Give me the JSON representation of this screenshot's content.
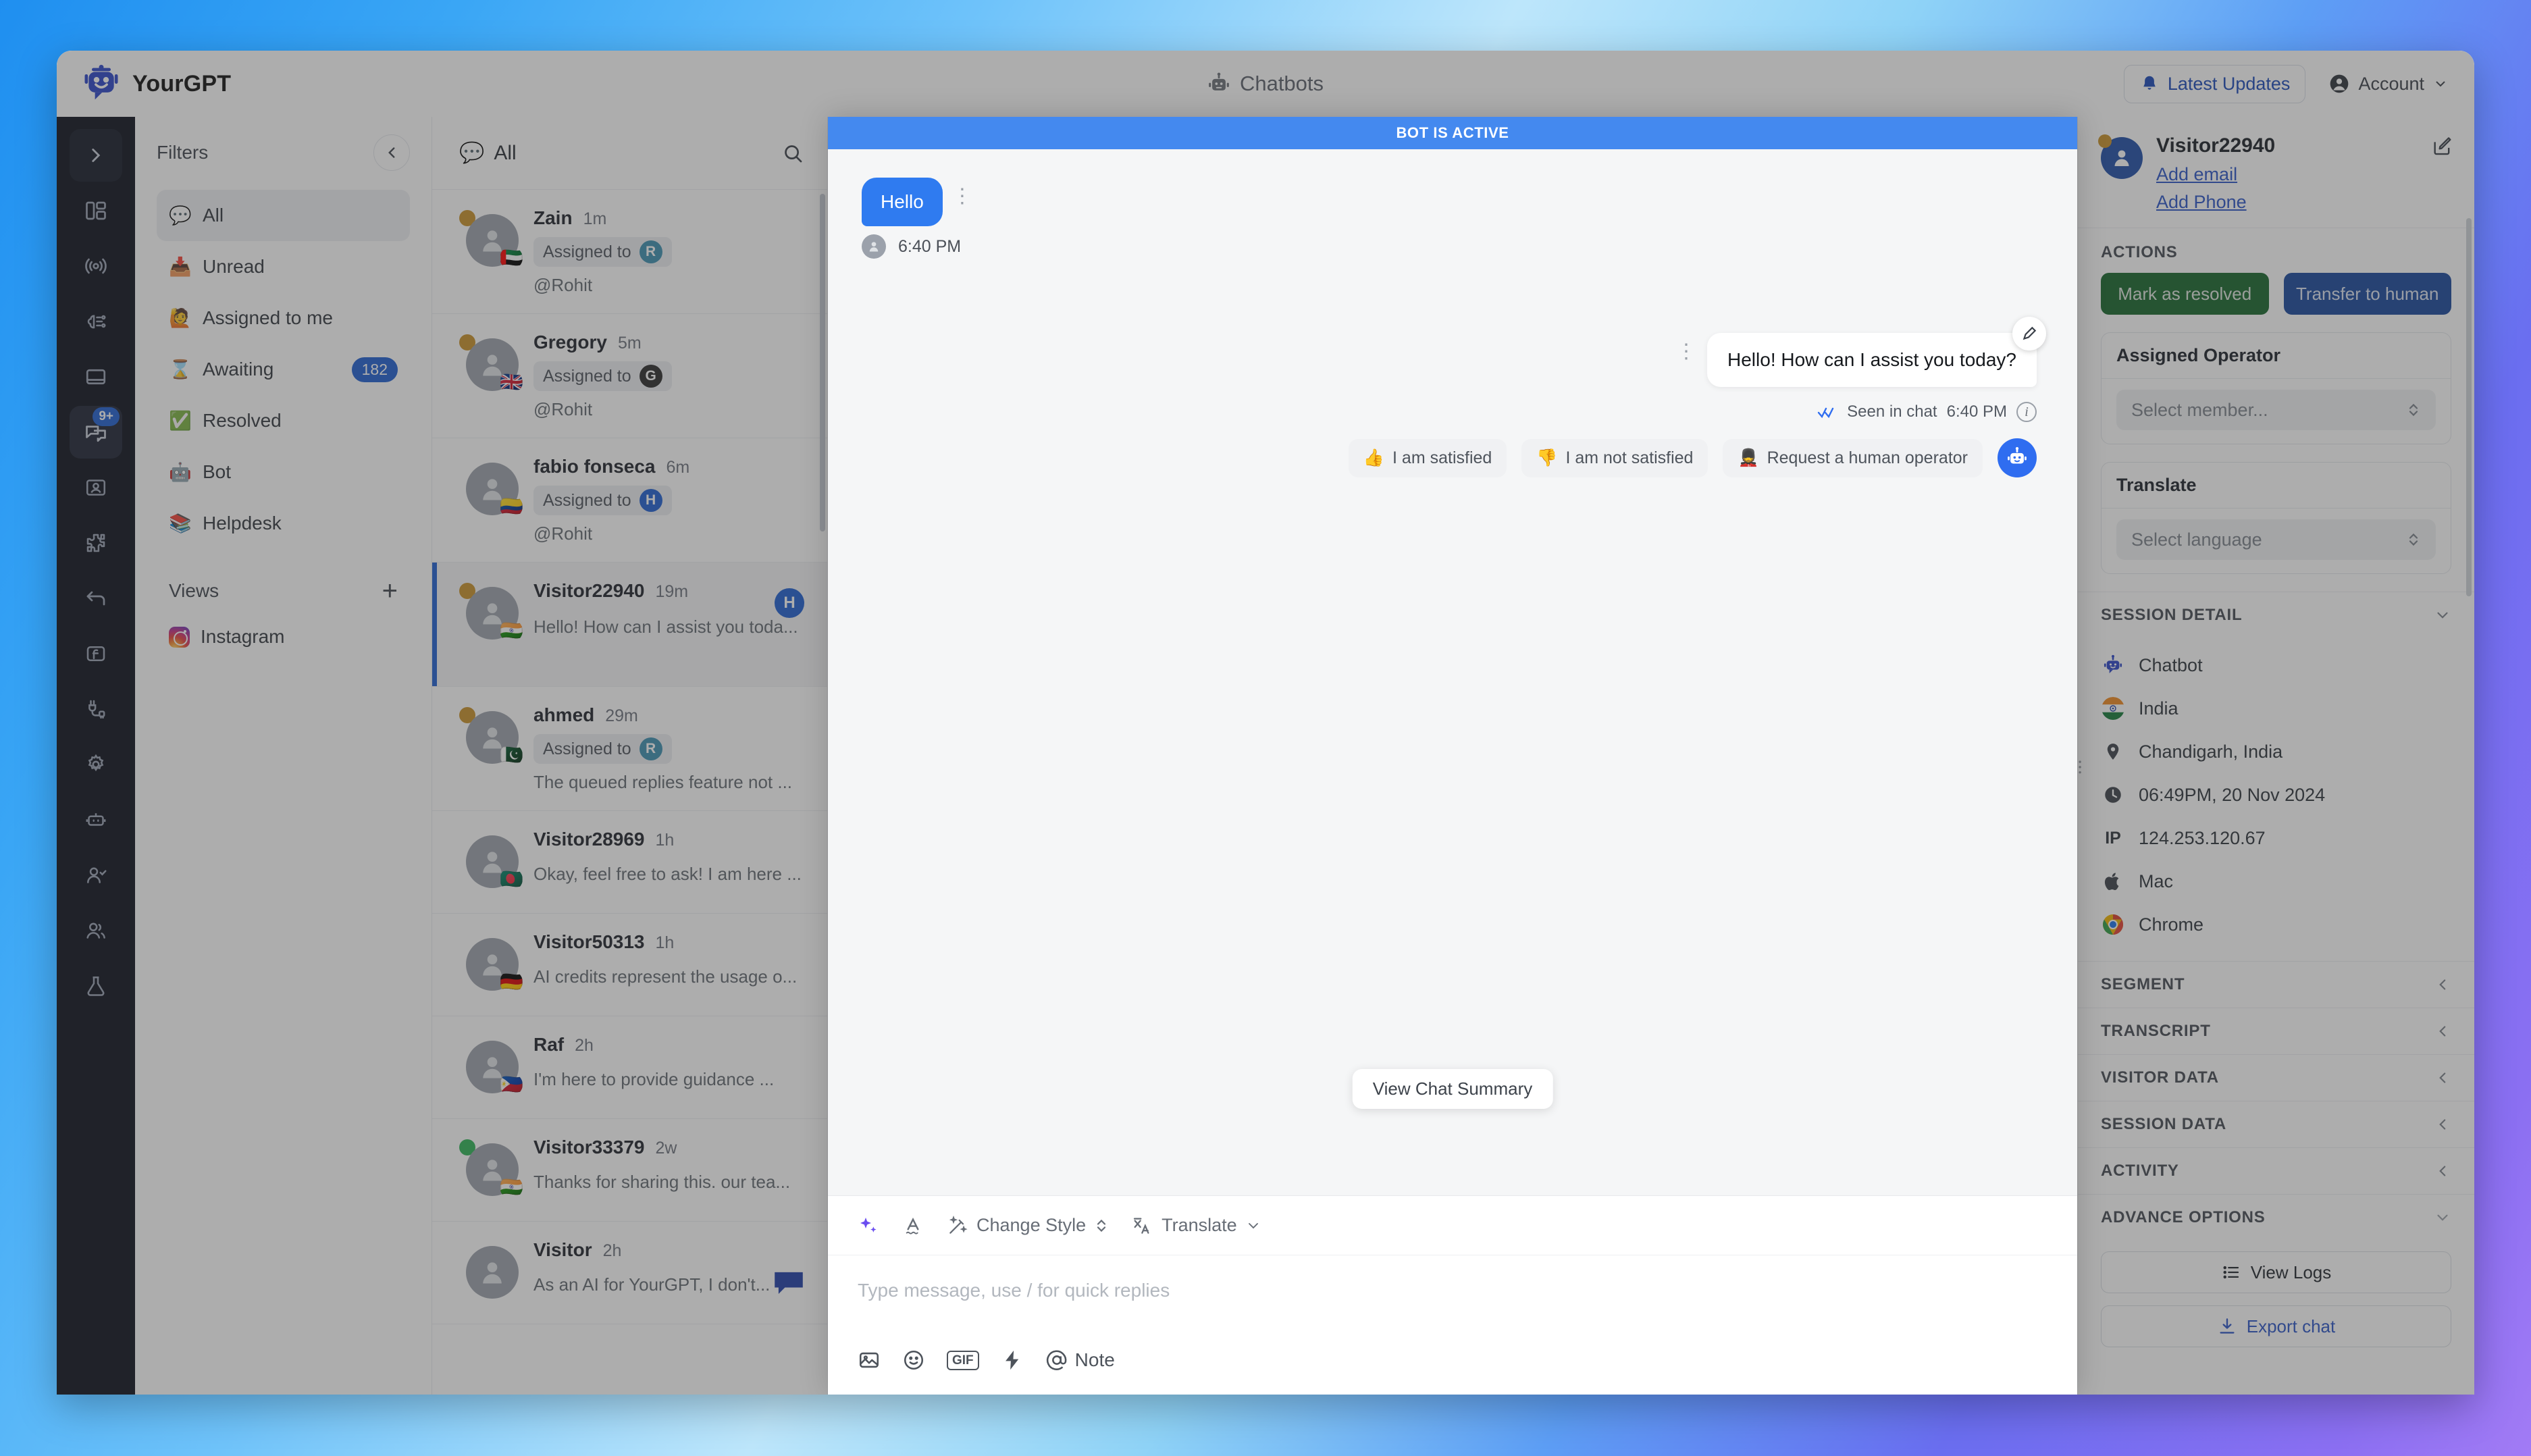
{
  "topbar": {
    "brand": "YourGPT",
    "center_title": "Chatbots",
    "updates_label": "Latest Updates",
    "account_label": "Account"
  },
  "rail": {
    "items": [
      {
        "name": "expand-chevron",
        "glyph": "chevron-right"
      },
      {
        "name": "dashboard",
        "glyph": "layout"
      },
      {
        "name": "broadcast",
        "glyph": "signal"
      },
      {
        "name": "ai-brain",
        "glyph": "brain"
      },
      {
        "name": "widget",
        "glyph": "window"
      },
      {
        "name": "inbox",
        "glyph": "chats",
        "badge": "9+"
      },
      {
        "name": "contacts",
        "glyph": "id-card"
      },
      {
        "name": "integrations",
        "glyph": "puzzle"
      },
      {
        "name": "automations",
        "glyph": "arrow-back"
      },
      {
        "name": "functions",
        "glyph": "function"
      },
      {
        "name": "connections",
        "glyph": "plug"
      },
      {
        "name": "settings",
        "glyph": "gear"
      },
      {
        "name": "bot",
        "glyph": "robot"
      },
      {
        "name": "agent-check",
        "glyph": "user-check"
      },
      {
        "name": "team",
        "glyph": "users"
      },
      {
        "name": "labs",
        "glyph": "flask"
      }
    ]
  },
  "filters": {
    "title": "Filters",
    "items": [
      {
        "emoji": "💬",
        "label": "All",
        "badge": "",
        "selected": true
      },
      {
        "emoji": "📥",
        "label": "Unread",
        "badge": "",
        "selected": false
      },
      {
        "emoji": "🙋",
        "label": "Assigned to me",
        "badge": "",
        "selected": false
      },
      {
        "emoji": "⌛",
        "label": "Awaiting",
        "badge": "182",
        "selected": false
      },
      {
        "emoji": "✅",
        "label": "Resolved",
        "badge": "",
        "selected": false
      },
      {
        "emoji": "🤖",
        "label": "Bot",
        "badge": "",
        "selected": false
      },
      {
        "emoji": "📚",
        "label": "Helpdesk",
        "badge": "",
        "selected": false
      }
    ],
    "views_title": "Views",
    "views": [
      {
        "icon": "instagram-icon",
        "label": "Instagram"
      }
    ]
  },
  "conversations": {
    "header_label": "All",
    "header_emoji": "💬",
    "rows": [
      {
        "name": "Zain",
        "time": "1m",
        "assigned_label": "Assigned to",
        "assignee_initial": "R",
        "assignee_color": "#3d8fb0",
        "sub": "@Rohit",
        "flag": "🇦🇪",
        "status": "#c8912a",
        "active": false,
        "badge": "",
        "chat_icon": false
      },
      {
        "name": "Gregory",
        "time": "5m",
        "assigned_label": "Assigned to",
        "assignee_initial": "G",
        "assignee_color": "#2b2b2b",
        "sub": "@Rohit",
        "flag": "🇬🇧",
        "status": "#c8912a",
        "active": false,
        "badge": "",
        "chat_icon": false
      },
      {
        "name": "fabio fonseca",
        "time": "6m",
        "assigned_label": "Assigned to",
        "assignee_initial": "H",
        "assignee_color": "#1f5fd0",
        "sub": "@Rohit",
        "flag": "🇨🇴",
        "status": "",
        "active": false,
        "badge": "",
        "chat_icon": false
      },
      {
        "name": "Visitor22940",
        "time": "19m",
        "assigned_label": "",
        "assignee_initial": "",
        "assignee_color": "",
        "sub": "Hello! How can I assist you toda...",
        "flag": "🇮🇳",
        "status": "#c8912a",
        "active": true,
        "badge": "H",
        "chat_icon": false
      },
      {
        "name": "ahmed",
        "time": "29m",
        "assigned_label": "Assigned to",
        "assignee_initial": "R",
        "assignee_color": "#3d8fb0",
        "sub": "The queued replies feature not ...",
        "flag": "🇵🇰",
        "status": "#c8912a",
        "active": false,
        "badge": "",
        "chat_icon": false
      },
      {
        "name": "Visitor28969",
        "time": "1h",
        "assigned_label": "",
        "assignee_initial": "",
        "assignee_color": "",
        "sub": "Okay, feel free to ask! I am here ...",
        "flag": "🇧🇩",
        "status": "",
        "active": false,
        "badge": "",
        "chat_icon": false
      },
      {
        "name": "Visitor50313",
        "time": "1h",
        "assigned_label": "",
        "assignee_initial": "",
        "assignee_color": "",
        "sub": "AI credits represent the usage o...",
        "flag": "🇩🇪",
        "status": "",
        "active": false,
        "badge": "",
        "chat_icon": false
      },
      {
        "name": "Raf",
        "time": "2h",
        "assigned_label": "",
        "assignee_initial": "",
        "assignee_color": "",
        "sub": "I'm here to provide guidance ...",
        "flag": "🇵🇭",
        "status": "",
        "active": false,
        "badge": "",
        "chat_icon": false
      },
      {
        "name": "Visitor33379",
        "time": "2w",
        "assigned_label": "",
        "assignee_initial": "",
        "assignee_color": "",
        "sub": "Thanks for sharing this. our tea...",
        "flag": "🇮🇳",
        "status": "#2fb457",
        "active": false,
        "badge": "",
        "chat_icon": false
      },
      {
        "name": "Visitor",
        "time": "2h",
        "assigned_label": "",
        "assignee_initial": "",
        "assignee_color": "",
        "sub": "As an AI for YourGPT, I don't...",
        "flag": "",
        "status": "",
        "active": false,
        "badge": "",
        "chat_icon": true
      }
    ]
  },
  "chat": {
    "status_bar": "BOT IS ACTIVE",
    "incoming": {
      "text": "Hello",
      "time": "6:40 PM"
    },
    "outgoing": {
      "text": "Hello! How can I assist you today?",
      "seen_label": "Seen in chat",
      "time": "6:40 PM"
    },
    "quick_replies": [
      {
        "emoji": "👍",
        "label": "I am satisfied"
      },
      {
        "emoji": "👎",
        "label": "I am not satisfied"
      },
      {
        "emoji": "💂",
        "label": "Request a human operator"
      }
    ],
    "summary_tooltip": "View Chat Summary"
  },
  "composer": {
    "tools": [
      {
        "icon": "sparkles-icon",
        "label": ""
      },
      {
        "icon": "font-style-icon",
        "label": ""
      },
      {
        "icon": "magic-wand-icon",
        "label": "Change Style"
      },
      {
        "icon": "translate-icon",
        "label": "Translate"
      }
    ],
    "placeholder": "Type message, use / for quick replies",
    "bottom_icons": [
      {
        "icon": "image-icon",
        "label": ""
      },
      {
        "icon": "emoji-icon",
        "label": ""
      },
      {
        "icon": "gif-icon",
        "label": "GIF"
      },
      {
        "icon": "lightning-icon",
        "label": ""
      },
      {
        "icon": "at-icon",
        "label": "Note"
      }
    ]
  },
  "rightbar": {
    "visitor_name": "Visitor22940",
    "add_email": "Add email",
    "add_phone": "Add Phone",
    "actions_title": "ACTIONS",
    "mark_resolved": "Mark as resolved",
    "transfer_human": "Transfer to human",
    "assigned_operator_title": "Assigned Operator",
    "assigned_operator_placeholder": "Select member...",
    "translate_title": "Translate",
    "translate_placeholder": "Select language",
    "session_detail_title": "SESSION DETAIL",
    "session_details": [
      {
        "icon": "chatbot-icon",
        "value": "Chatbot"
      },
      {
        "icon": "flag-india-icon",
        "value": "India"
      },
      {
        "icon": "location-pin-icon",
        "value": "Chandigarh, India"
      },
      {
        "icon": "clock-icon",
        "value": "06:49PM, 20 Nov 2024"
      },
      {
        "icon": "ip-icon",
        "value": "124.253.120.67"
      },
      {
        "icon": "apple-icon",
        "value": "Mac"
      },
      {
        "icon": "chrome-icon",
        "value": "Chrome"
      }
    ],
    "accordions": [
      {
        "title": "SEGMENT",
        "state": "collapsed"
      },
      {
        "title": "TRANSCRIPT",
        "state": "collapsed"
      },
      {
        "title": "VISITOR DATA",
        "state": "collapsed"
      },
      {
        "title": "SESSION DATA",
        "state": "collapsed"
      },
      {
        "title": "ACTIVITY",
        "state": "collapsed"
      },
      {
        "title": "ADVANCE OPTIONS",
        "state": "expanded"
      }
    ],
    "view_logs": "View Logs",
    "export_chat": "Export chat"
  },
  "colors": {
    "accent_blue": "#1f5fd0",
    "bot_bar_blue": "#4489ef",
    "bubble_in_blue": "#2f7bf0",
    "resolve_green": "#17662c",
    "transfer_blue": "#19479c",
    "rail_dark": "#0d111c"
  }
}
